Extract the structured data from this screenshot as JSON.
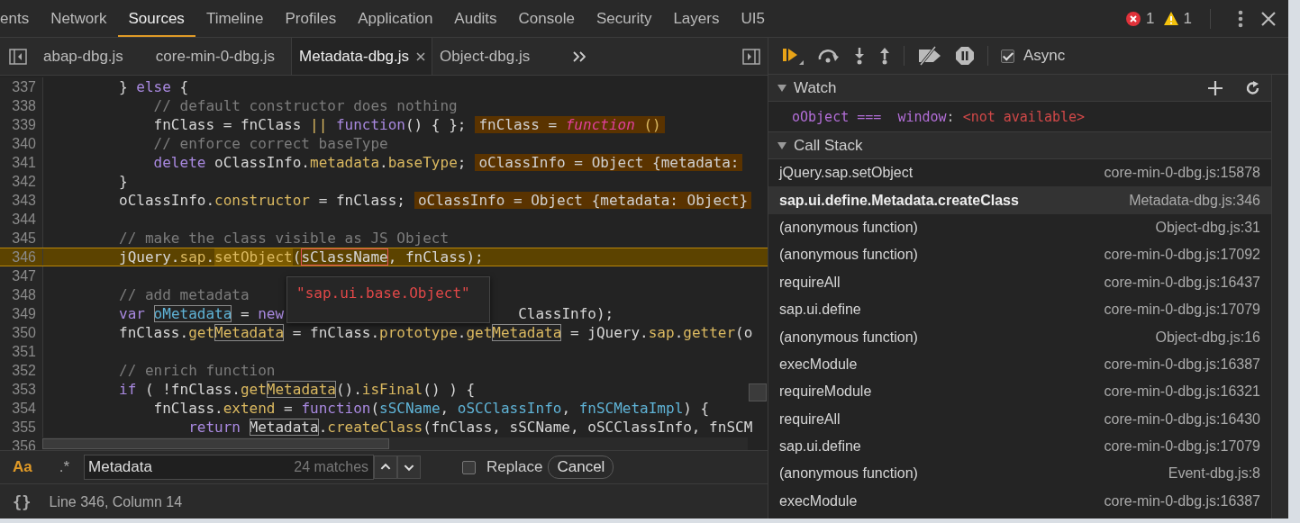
{
  "top_tabs": [
    {
      "label": "ents",
      "selected": false
    },
    {
      "label": "Network",
      "selected": false
    },
    {
      "label": "Sources",
      "selected": true
    },
    {
      "label": "Timeline",
      "selected": false
    },
    {
      "label": "Profiles",
      "selected": false
    },
    {
      "label": "Application",
      "selected": false
    },
    {
      "label": "Audits",
      "selected": false
    },
    {
      "label": "Console",
      "selected": false
    },
    {
      "label": "Security",
      "selected": false
    },
    {
      "label": "Layers",
      "selected": false
    },
    {
      "label": "UI5",
      "selected": false
    }
  ],
  "counters": {
    "errors": "1",
    "warnings": "1"
  },
  "file_tabs": [
    {
      "label": "abap-dbg.js",
      "selected": false,
      "closable": false
    },
    {
      "label": "core-min-0-dbg.js",
      "selected": false,
      "closable": false
    },
    {
      "label": "Metadata-dbg.js",
      "selected": true,
      "closable": true
    },
    {
      "label": "Object-dbg.js",
      "selected": false,
      "closable": false
    }
  ],
  "code": {
    "lines": [
      {
        "number": "337",
        "paused": false,
        "segments": [
          {
            "text": "        } ",
            "kind": "plain"
          },
          {
            "text": "else",
            "kind": "keyword"
          },
          {
            "text": " {",
            "kind": "plain"
          }
        ]
      },
      {
        "number": "338",
        "paused": false,
        "segments": [
          {
            "text": "            // default constructor does nothing",
            "kind": "comment"
          }
        ]
      },
      {
        "number": "339",
        "paused": false,
        "segments": [
          {
            "text": "            fnClass = fnClass ",
            "kind": "plain"
          },
          {
            "text": "||",
            "kind": "member"
          },
          {
            "text": " function",
            "kind": "keyword"
          },
          {
            "text": "() { };",
            "kind": "plain"
          }
        ],
        "inline_value": [
          {
            "text": "fnClass = ",
            "kind": "plain"
          },
          {
            "text": "function",
            "kind": "function"
          },
          {
            "text": " ()",
            "kind": "member"
          }
        ]
      },
      {
        "number": "340",
        "paused": false,
        "segments": [
          {
            "text": "            // enforce correct baseType",
            "kind": "comment"
          }
        ]
      },
      {
        "number": "341",
        "paused": false,
        "segments": [
          {
            "text": "            delete",
            "kind": "keyword"
          },
          {
            "text": " oClassInfo.",
            "kind": "plain"
          },
          {
            "text": "metadata",
            "kind": "member"
          },
          {
            "text": ".",
            "kind": "plain"
          },
          {
            "text": "baseType",
            "kind": "member"
          },
          {
            "text": ";",
            "kind": "plain"
          }
        ],
        "inline_value": [
          {
            "text": "oClassInfo = Object {metadata:",
            "kind": "plain"
          }
        ]
      },
      {
        "number": "342",
        "paused": false,
        "segments": [
          {
            "text": "        }",
            "kind": "plain"
          }
        ]
      },
      {
        "number": "343",
        "paused": false,
        "segments": [
          {
            "text": "        oClassInfo.",
            "kind": "plain"
          },
          {
            "text": "constructor",
            "kind": "member"
          },
          {
            "text": " = fnClass;",
            "kind": "plain"
          }
        ],
        "inline_value": [
          {
            "text": "oClassInfo = Object {metadata: Object}",
            "kind": "plain"
          }
        ]
      },
      {
        "number": "344",
        "paused": false
      },
      {
        "number": "345",
        "paused": false,
        "segments": [
          {
            "text": "        // make the class visible as JS Object",
            "kind": "comment"
          }
        ]
      },
      {
        "number": "346",
        "paused": true,
        "segments": [
          {
            "text": "        jQuery.",
            "kind": "plain"
          },
          {
            "text": "sap",
            "kind": "member"
          },
          {
            "text": ".",
            "kind": "plain"
          },
          {
            "text": "setObject",
            "kind": "current"
          },
          {
            "text": "(",
            "kind": "plain"
          },
          {
            "text": "sClassName",
            "kind": "hovered"
          },
          {
            "text": ", fnClass);",
            "kind": "plain"
          }
        ]
      },
      {
        "number": "347",
        "paused": false
      },
      {
        "number": "348",
        "paused": false,
        "segments": [
          {
            "text": "        // add metadata",
            "kind": "comment"
          }
        ]
      },
      {
        "number": "349",
        "paused": false,
        "segments": [
          {
            "text": "        var",
            "kind": "keyword"
          },
          {
            "text": " oMetadata",
            "kind": "param",
            "match": true
          },
          {
            "text": " = ",
            "kind": "plain"
          },
          {
            "text": "new",
            "kind": "keyword"
          },
          {
            "kind": "covered"
          },
          {
            "text": "ClassInfo);",
            "kind": "plain"
          }
        ]
      },
      {
        "number": "350",
        "paused": false,
        "segments": [
          {
            "text": "        fnClass.",
            "kind": "plain"
          },
          {
            "text": "get",
            "kind": "member"
          },
          {
            "text": "Metadata",
            "kind": "member",
            "match": true
          },
          {
            "text": " = fnClass.",
            "kind": "plain"
          },
          {
            "text": "prototype",
            "kind": "member"
          },
          {
            "text": ".",
            "kind": "plain"
          },
          {
            "text": "get",
            "kind": "member"
          },
          {
            "text": "Metadata",
            "kind": "member",
            "match": true
          },
          {
            "text": " = jQuery.",
            "kind": "plain"
          },
          {
            "text": "sap",
            "kind": "member"
          },
          {
            "text": ".",
            "kind": "plain"
          },
          {
            "text": "getter",
            "kind": "member"
          },
          {
            "text": "(o",
            "kind": "plain"
          }
        ]
      },
      {
        "number": "351",
        "paused": false
      },
      {
        "number": "352",
        "paused": false,
        "segments": [
          {
            "text": "        // enrich function",
            "kind": "comment"
          }
        ]
      },
      {
        "number": "353",
        "paused": false,
        "segments": [
          {
            "text": "        if",
            "kind": "keyword"
          },
          {
            "text": " ( !fnClass.",
            "kind": "plain"
          },
          {
            "text": "get",
            "kind": "member"
          },
          {
            "text": "Metadata",
            "kind": "member",
            "match": true
          },
          {
            "text": "().",
            "kind": "plain"
          },
          {
            "text": "isFinal",
            "kind": "member"
          },
          {
            "text": "() ) {",
            "kind": "plain"
          }
        ]
      },
      {
        "number": "354",
        "paused": false,
        "segments": [
          {
            "text": "            fnClass.",
            "kind": "plain"
          },
          {
            "text": "extend",
            "kind": "member"
          },
          {
            "text": " = ",
            "kind": "plain"
          },
          {
            "text": "function",
            "kind": "keyword"
          },
          {
            "text": "(",
            "kind": "plain"
          },
          {
            "text": "sSCName",
            "kind": "param"
          },
          {
            "text": ", ",
            "kind": "plain"
          },
          {
            "text": "oSCClassInfo",
            "kind": "param"
          },
          {
            "text": ", ",
            "kind": "plain"
          },
          {
            "text": "fnSCMetaImpl",
            "kind": "param"
          },
          {
            "text": ") {",
            "kind": "plain"
          }
        ]
      },
      {
        "number": "355",
        "paused": false,
        "segments": [
          {
            "text": "                return",
            "kind": "keyword"
          },
          {
            "text": " Metadata",
            "kind": "plain",
            "match": true
          },
          {
            "text": ".",
            "kind": "plain"
          },
          {
            "text": "createClass",
            "kind": "member"
          },
          {
            "text": "(fnClass, sSCName, oSCClassInfo, fnSCM",
            "kind": "plain"
          }
        ]
      },
      {
        "number": "356",
        "paused": false
      }
    ],
    "tooltip": {
      "value": "\"sap.ui.base.Object\""
    }
  },
  "search": {
    "case_toggle": {
      "label": "Aa",
      "on": true
    },
    "regex_toggle": {
      "label": ".*",
      "on": false
    },
    "value": "Metadata",
    "matches": "24 matches",
    "replace": {
      "label": "Replace",
      "checked": false
    },
    "cancel": "Cancel"
  },
  "status_bar": {
    "pretty_print": "{}",
    "position": "Line 346, Column 14"
  },
  "debugger": {
    "async": {
      "label": "Async",
      "checked": true
    },
    "watch": {
      "title": "Watch",
      "expanded": true,
      "expressions": [
        {
          "expression": "oObject ===  window",
          "separator": ":",
          "value": "<not available>"
        }
      ]
    },
    "call_stack": {
      "title": "Call Stack",
      "expanded": true,
      "frames": [
        {
          "function": "jQuery.sap.setObject",
          "location": "core-min-0-dbg.js:15878",
          "selected": false
        },
        {
          "function": "sap.ui.define.Metadata.createClass",
          "location": "Metadata-dbg.js:346",
          "selected": true
        },
        {
          "function": "(anonymous function)",
          "location": "Object-dbg.js:31",
          "selected": false
        },
        {
          "function": "(anonymous function)",
          "location": "core-min-0-dbg.js:17092",
          "selected": false
        },
        {
          "function": "requireAll",
          "location": "core-min-0-dbg.js:16437",
          "selected": false
        },
        {
          "function": "sap.ui.define",
          "location": "core-min-0-dbg.js:17079",
          "selected": false
        },
        {
          "function": "(anonymous function)",
          "location": "Object-dbg.js:16",
          "selected": false
        },
        {
          "function": "execModule",
          "location": "core-min-0-dbg.js:16387",
          "selected": false
        },
        {
          "function": "requireModule",
          "location": "core-min-0-dbg.js:16321",
          "selected": false
        },
        {
          "function": "requireAll",
          "location": "core-min-0-dbg.js:16430",
          "selected": false
        },
        {
          "function": "sap.ui.define",
          "location": "core-min-0-dbg.js:17079",
          "selected": false
        },
        {
          "function": "(anonymous function)",
          "location": "Event-dbg.js:8",
          "selected": false
        },
        {
          "function": "execModule",
          "location": "core-min-0-dbg.js:16387",
          "selected": false
        }
      ]
    }
  }
}
